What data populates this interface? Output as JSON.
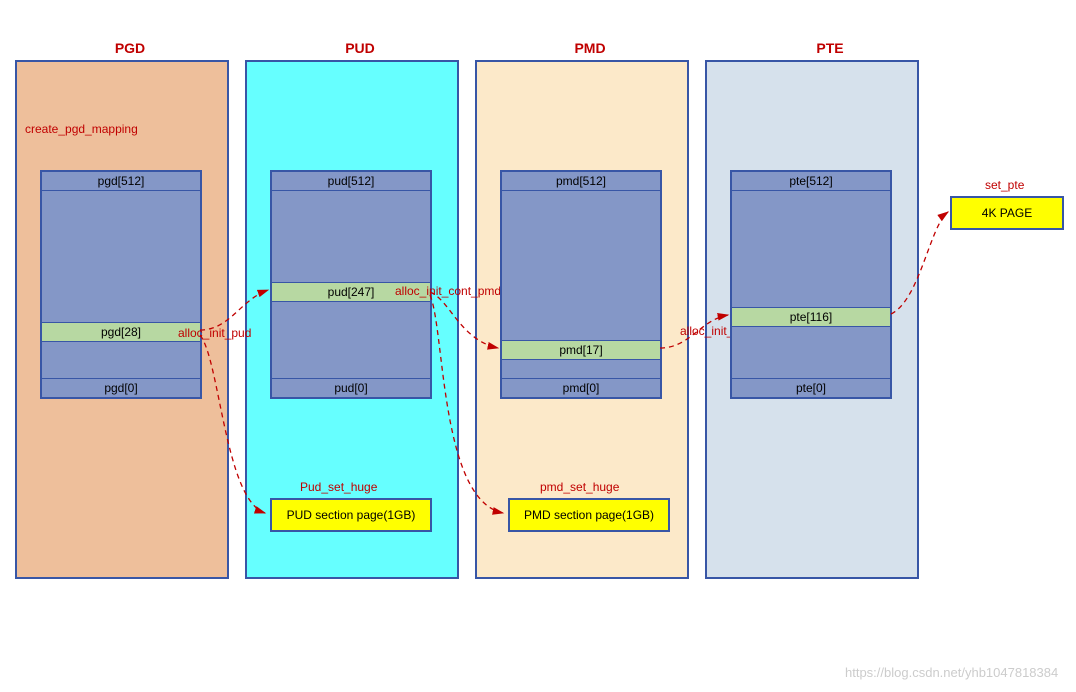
{
  "titles": {
    "pgd": "PGD",
    "pud": "PUD",
    "pmd": "PMD",
    "pte": "PTE"
  },
  "labels": {
    "create_pgd_mapping": "create_pgd_mapping",
    "alloc_init_pud": "alloc_init_pud",
    "alloc_init_cont_pmd": "alloc_init_cont_pmd",
    "alloc_init_cont_pte": "alloc_init_cont_pte",
    "pud_set_huge": "Pud_set_huge",
    "pmd_set_huge": "pmd_set_huge",
    "set_pte": "set_pte"
  },
  "pgd": {
    "top": "pgd[512]",
    "sel": "pgd[28]",
    "bot": "pgd[0]"
  },
  "pud": {
    "top": "pud[512]",
    "sel": "pud[247]",
    "bot": "pud[0]"
  },
  "pmd": {
    "top": "pmd[512]",
    "sel": "pmd[17]",
    "bot": "pmd[0]"
  },
  "pte": {
    "top": "pte[512]",
    "sel": "pte[116]",
    "bot": "pte[0]"
  },
  "boxes": {
    "pud_section": "PUD section page(1GB)",
    "pmd_section": "PMD section page(1GB)",
    "page4k": "4K PAGE"
  },
  "watermark": "https://blog.csdn.net/yhb1047818384"
}
